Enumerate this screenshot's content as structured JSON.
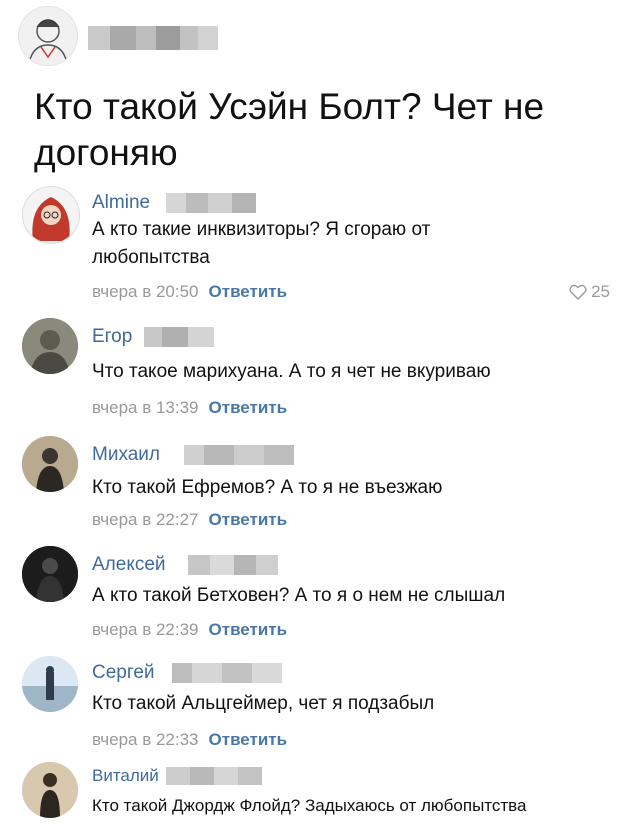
{
  "post": {
    "text": "Кто такой Усэйн Болт? Чет не догоняю"
  },
  "comments": [
    {
      "name": "Almine",
      "text": "А кто такие инквизиторы? Я сгораю от любопытства",
      "time": "вчера в 20:50",
      "reply_label": "Ответить",
      "likes": "25"
    },
    {
      "name": "Егор",
      "text": "Что такое марихуана. А то я чет не вкуриваю",
      "time": "вчера в 13:39",
      "reply_label": "Ответить"
    },
    {
      "name": "Михаил",
      "text": "Кто такой Ефремов? А то я не въезжаю",
      "time": "вчера в 22:27",
      "reply_label": "Ответить"
    },
    {
      "name": "Алексей",
      "text": "А кто такой Бетховен? А то я о нем не слышал",
      "time": "вчера в 22:39",
      "reply_label": "Ответить"
    },
    {
      "name": "Сергей",
      "text": "Кто такой Альцгеймер, чет я подзабыл",
      "time": "вчера в 22:33",
      "reply_label": "Ответить"
    },
    {
      "name": "Виталий",
      "text": "Кто такой Джордж Флойд? Задыхаюсь от любопытства"
    }
  ],
  "colors": {
    "name_link": "#3f6a9a",
    "reply_link": "#4b77a6",
    "meta_gray": "#999999"
  },
  "icons": {
    "like": "heart-outline-icon"
  }
}
